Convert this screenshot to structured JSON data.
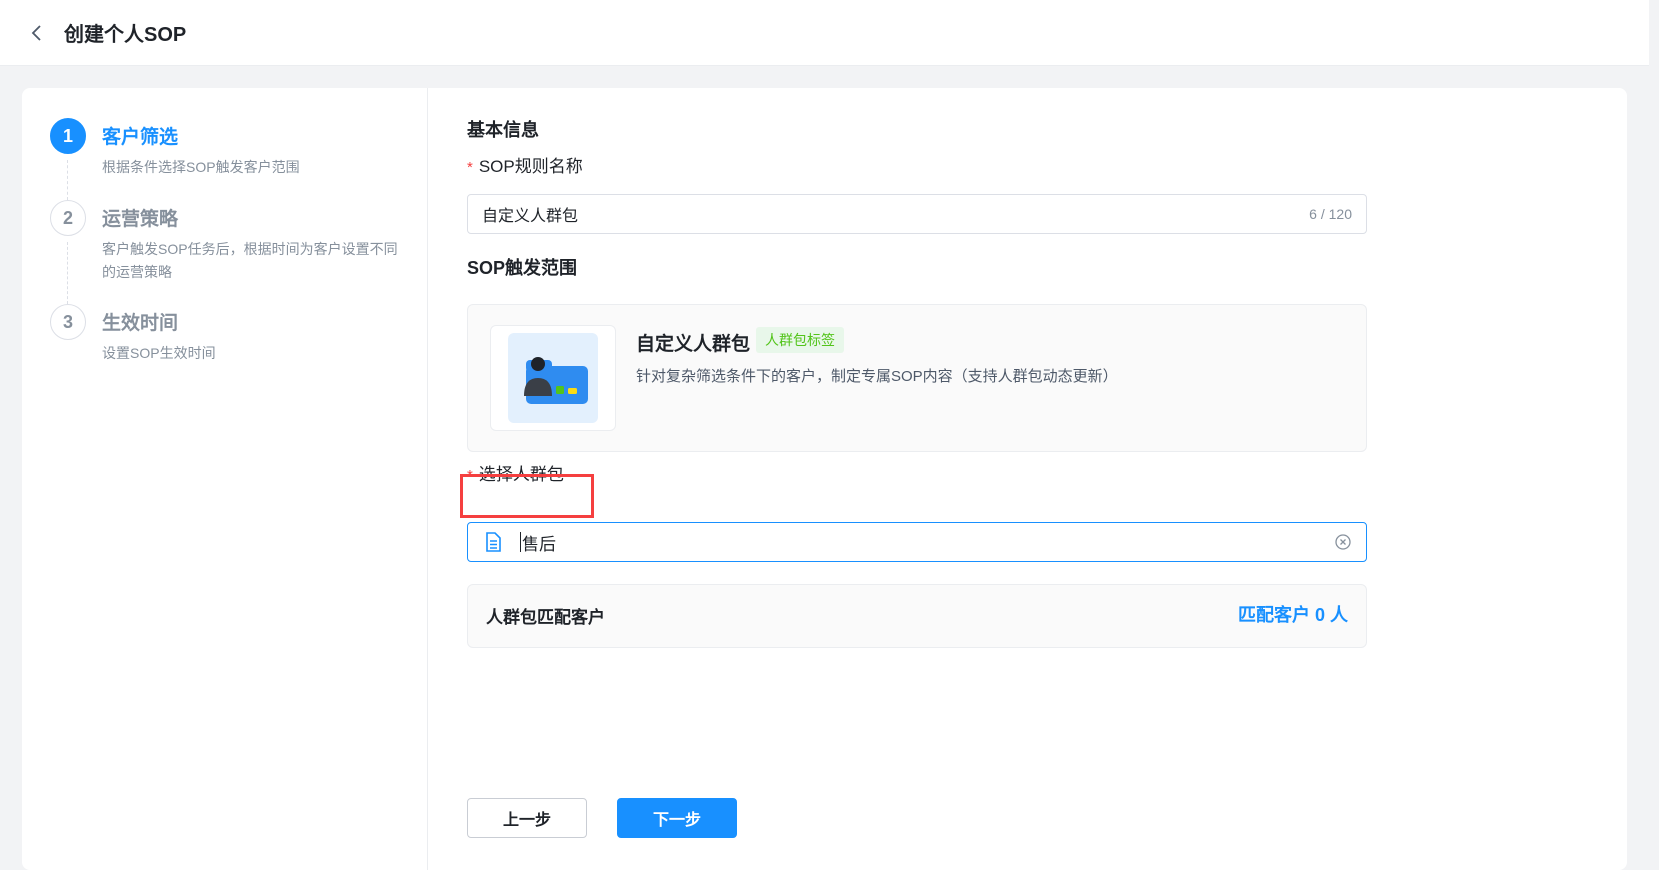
{
  "header": {
    "title": "创建个人SOP"
  },
  "steps": [
    {
      "num": "1",
      "title": "客户筛选",
      "desc": "根据条件选择SOP触发客户范围"
    },
    {
      "num": "2",
      "title": "运营策略",
      "desc": "客户触发SOP任务后，根据时间为客户设置不同的运营策略"
    },
    {
      "num": "3",
      "title": "生效时间",
      "desc": "设置SOP生效时间"
    }
  ],
  "form": {
    "basic_info_title": "基本信息",
    "rule_name_label": "SOP规则名称",
    "required_mark": "*",
    "rule_name_value": "自定义人群包",
    "rule_name_count": "6 / 120",
    "scope_title": "SOP触发范围",
    "scope": {
      "name": "自定义人群包",
      "tag": "人群包标签",
      "desc": "针对复杂筛选条件下的客户，制定专属SOP内容（支持人群包动态更新）"
    },
    "select_label": "选择人群包",
    "select_value": "售后",
    "match_label": "人群包匹配客户",
    "match_count": "匹配客户 0 人"
  },
  "buttons": {
    "prev": "上一步",
    "next": "下一步"
  },
  "colors": {
    "primary": "#1890ff",
    "required": "#f53f3f",
    "tag_green": "#52c41a"
  }
}
